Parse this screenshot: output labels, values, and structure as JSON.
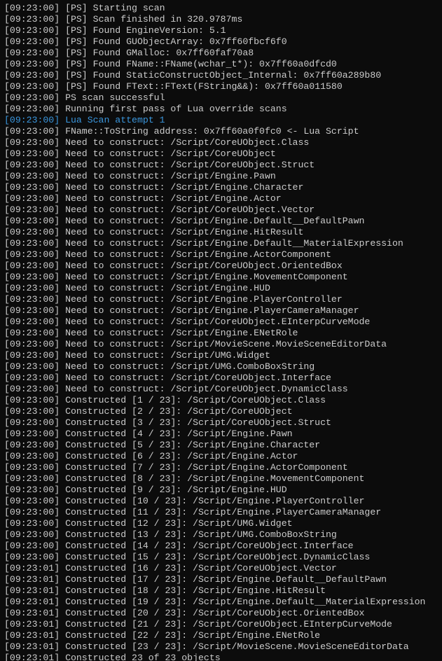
{
  "lines": [
    {
      "ts": "[09:23:00]",
      "tag": "[PS]",
      "msg": "Starting scan",
      "hl": false
    },
    {
      "ts": "[09:23:00]",
      "tag": "[PS]",
      "msg": "Scan finished in 320.9787ms",
      "hl": false
    },
    {
      "ts": "[09:23:00]",
      "tag": "[PS]",
      "msg": "Found EngineVersion: 5.1",
      "hl": false
    },
    {
      "ts": "[09:23:00]",
      "tag": "[PS]",
      "msg": "Found GUObjectArray: 0x7ff60fbcf6f0",
      "hl": false
    },
    {
      "ts": "[09:23:00]",
      "tag": "[PS]",
      "msg": "Found GMalloc: 0x7ff60faf70a8",
      "hl": false
    },
    {
      "ts": "[09:23:00]",
      "tag": "[PS]",
      "msg": "Found FName::FName(wchar_t*): 0x7ff60a0dfcd0",
      "hl": false
    },
    {
      "ts": "[09:23:00]",
      "tag": "[PS]",
      "msg": "Found StaticConstructObject_Internal: 0x7ff60a289b80",
      "hl": false
    },
    {
      "ts": "[09:23:00]",
      "tag": "[PS]",
      "msg": "Found FText::FText(FString&&): 0x7ff60a011580",
      "hl": false
    },
    {
      "ts": "[09:23:00]",
      "tag": "",
      "msg": "PS scan successful",
      "hl": false
    },
    {
      "ts": "[09:23:00]",
      "tag": "",
      "msg": "Running first pass of Lua override scans",
      "hl": false
    },
    {
      "ts": "[09:23:00]",
      "tag": "",
      "msg": "Lua Scan attempt 1",
      "hl": true
    },
    {
      "ts": "[09:23:00]",
      "tag": "",
      "msg": "FName::ToString address: 0x7ff60a0f0fc0 <- Lua Script",
      "hl": false
    },
    {
      "ts": "[09:23:00]",
      "tag": "",
      "msg": "Need to construct: /Script/CoreUObject.Class",
      "hl": false
    },
    {
      "ts": "[09:23:00]",
      "tag": "",
      "msg": "Need to construct: /Script/CoreUObject",
      "hl": false
    },
    {
      "ts": "[09:23:00]",
      "tag": "",
      "msg": "Need to construct: /Script/CoreUObject.Struct",
      "hl": false
    },
    {
      "ts": "[09:23:00]",
      "tag": "",
      "msg": "Need to construct: /Script/Engine.Pawn",
      "hl": false
    },
    {
      "ts": "[09:23:00]",
      "tag": "",
      "msg": "Need to construct: /Script/Engine.Character",
      "hl": false
    },
    {
      "ts": "[09:23:00]",
      "tag": "",
      "msg": "Need to construct: /Script/Engine.Actor",
      "hl": false
    },
    {
      "ts": "[09:23:00]",
      "tag": "",
      "msg": "Need to construct: /Script/CoreUObject.Vector",
      "hl": false
    },
    {
      "ts": "[09:23:00]",
      "tag": "",
      "msg": "Need to construct: /Script/Engine.Default__DefaultPawn",
      "hl": false
    },
    {
      "ts": "[09:23:00]",
      "tag": "",
      "msg": "Need to construct: /Script/Engine.HitResult",
      "hl": false
    },
    {
      "ts": "[09:23:00]",
      "tag": "",
      "msg": "Need to construct: /Script/Engine.Default__MaterialExpression",
      "hl": false
    },
    {
      "ts": "[09:23:00]",
      "tag": "",
      "msg": "Need to construct: /Script/Engine.ActorComponent",
      "hl": false
    },
    {
      "ts": "[09:23:00]",
      "tag": "",
      "msg": "Need to construct: /Script/CoreUObject.OrientedBox",
      "hl": false
    },
    {
      "ts": "[09:23:00]",
      "tag": "",
      "msg": "Need to construct: /Script/Engine.MovementComponent",
      "hl": false
    },
    {
      "ts": "[09:23:00]",
      "tag": "",
      "msg": "Need to construct: /Script/Engine.HUD",
      "hl": false
    },
    {
      "ts": "[09:23:00]",
      "tag": "",
      "msg": "Need to construct: /Script/Engine.PlayerController",
      "hl": false
    },
    {
      "ts": "[09:23:00]",
      "tag": "",
      "msg": "Need to construct: /Script/Engine.PlayerCameraManager",
      "hl": false
    },
    {
      "ts": "[09:23:00]",
      "tag": "",
      "msg": "Need to construct: /Script/CoreUObject.EInterpCurveMode",
      "hl": false
    },
    {
      "ts": "[09:23:00]",
      "tag": "",
      "msg": "Need to construct: /Script/Engine.ENetRole",
      "hl": false
    },
    {
      "ts": "[09:23:00]",
      "tag": "",
      "msg": "Need to construct: /Script/MovieScene.MovieSceneEditorData",
      "hl": false
    },
    {
      "ts": "[09:23:00]",
      "tag": "",
      "msg": "Need to construct: /Script/UMG.Widget",
      "hl": false
    },
    {
      "ts": "[09:23:00]",
      "tag": "",
      "msg": "Need to construct: /Script/UMG.ComboBoxString",
      "hl": false
    },
    {
      "ts": "[09:23:00]",
      "tag": "",
      "msg": "Need to construct: /Script/CoreUObject.Interface",
      "hl": false
    },
    {
      "ts": "[09:23:00]",
      "tag": "",
      "msg": "Need to construct: /Script/CoreUObject.DynamicClass",
      "hl": false
    },
    {
      "ts": "[09:23:00]",
      "tag": "",
      "msg": "Constructed [1 / 23]: /Script/CoreUObject.Class",
      "hl": false
    },
    {
      "ts": "[09:23:00]",
      "tag": "",
      "msg": "Constructed [2 / 23]: /Script/CoreUObject",
      "hl": false
    },
    {
      "ts": "[09:23:00]",
      "tag": "",
      "msg": "Constructed [3 / 23]: /Script/CoreUObject.Struct",
      "hl": false
    },
    {
      "ts": "[09:23:00]",
      "tag": "",
      "msg": "Constructed [4 / 23]: /Script/Engine.Pawn",
      "hl": false
    },
    {
      "ts": "[09:23:00]",
      "tag": "",
      "msg": "Constructed [5 / 23]: /Script/Engine.Character",
      "hl": false
    },
    {
      "ts": "[09:23:00]",
      "tag": "",
      "msg": "Constructed [6 / 23]: /Script/Engine.Actor",
      "hl": false
    },
    {
      "ts": "[09:23:00]",
      "tag": "",
      "msg": "Constructed [7 / 23]: /Script/Engine.ActorComponent",
      "hl": false
    },
    {
      "ts": "[09:23:00]",
      "tag": "",
      "msg": "Constructed [8 / 23]: /Script/Engine.MovementComponent",
      "hl": false
    },
    {
      "ts": "[09:23:00]",
      "tag": "",
      "msg": "Constructed [9 / 23]: /Script/Engine.HUD",
      "hl": false
    },
    {
      "ts": "[09:23:00]",
      "tag": "",
      "msg": "Constructed [10 / 23]: /Script/Engine.PlayerController",
      "hl": false
    },
    {
      "ts": "[09:23:00]",
      "tag": "",
      "msg": "Constructed [11 / 23]: /Script/Engine.PlayerCameraManager",
      "hl": false
    },
    {
      "ts": "[09:23:00]",
      "tag": "",
      "msg": "Constructed [12 / 23]: /Script/UMG.Widget",
      "hl": false
    },
    {
      "ts": "[09:23:00]",
      "tag": "",
      "msg": "Constructed [13 / 23]: /Script/UMG.ComboBoxString",
      "hl": false
    },
    {
      "ts": "[09:23:00]",
      "tag": "",
      "msg": "Constructed [14 / 23]: /Script/CoreUObject.Interface",
      "hl": false
    },
    {
      "ts": "[09:23:00]",
      "tag": "",
      "msg": "Constructed [15 / 23]: /Script/CoreUObject.DynamicClass",
      "hl": false
    },
    {
      "ts": "[09:23:01]",
      "tag": "",
      "msg": "Constructed [16 / 23]: /Script/CoreUObject.Vector",
      "hl": false
    },
    {
      "ts": "[09:23:01]",
      "tag": "",
      "msg": "Constructed [17 / 23]: /Script/Engine.Default__DefaultPawn",
      "hl": false
    },
    {
      "ts": "[09:23:01]",
      "tag": "",
      "msg": "Constructed [18 / 23]: /Script/Engine.HitResult",
      "hl": false
    },
    {
      "ts": "[09:23:01]",
      "tag": "",
      "msg": "Constructed [19 / 23]: /Script/Engine.Default__MaterialExpression",
      "hl": false
    },
    {
      "ts": "[09:23:01]",
      "tag": "",
      "msg": "Constructed [20 / 23]: /Script/CoreUObject.OrientedBox",
      "hl": false
    },
    {
      "ts": "[09:23:01]",
      "tag": "",
      "msg": "Constructed [21 / 23]: /Script/CoreUObject.EInterpCurveMode",
      "hl": false
    },
    {
      "ts": "[09:23:01]",
      "tag": "",
      "msg": "Constructed [22 / 23]: /Script/Engine.ENetRole",
      "hl": false
    },
    {
      "ts": "[09:23:01]",
      "tag": "",
      "msg": "Constructed [23 / 23]: /Script/MovieScene.MovieSceneEditorData",
      "hl": false
    },
    {
      "ts": "[09:23:01]",
      "tag": "",
      "msg": "Constructed 23 of 23 objects",
      "hl": false
    }
  ]
}
